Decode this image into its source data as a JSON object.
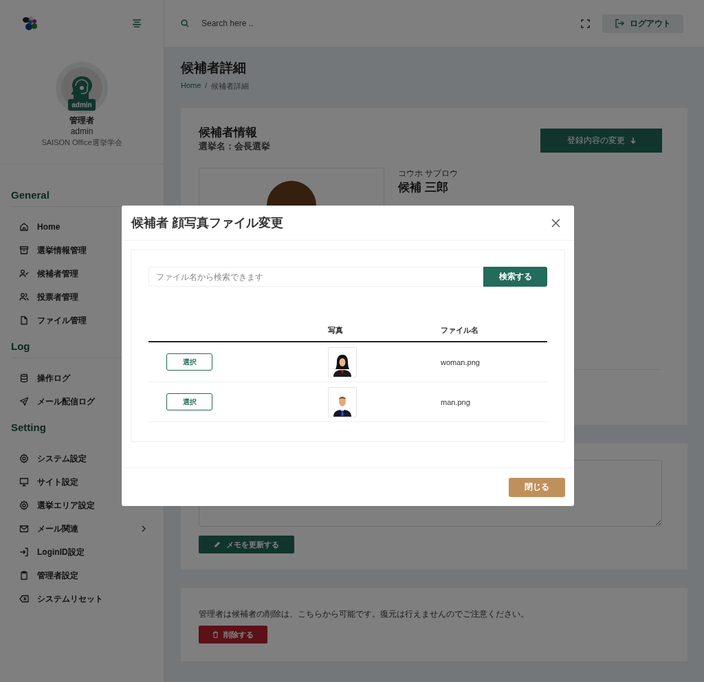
{
  "topbar": {
    "search_placeholder": "Search here ..",
    "logout_button": "ログアウト"
  },
  "profile": {
    "badge": "admin",
    "role": "管理者",
    "username": "admin",
    "organization": "SAISON Office選挙学会"
  },
  "sidebar": {
    "sections": [
      {
        "title": "General",
        "underline": true,
        "items": [
          {
            "label": "Home"
          },
          {
            "label": "選挙情報管理"
          },
          {
            "label": "候補者管理"
          },
          {
            "label": "投票者管理"
          },
          {
            "label": "ファイル管理"
          }
        ]
      },
      {
        "title": "Log",
        "underline": true,
        "items": [
          {
            "label": "操作ログ"
          },
          {
            "label": "メール配信ログ"
          }
        ]
      },
      {
        "title": "Setting",
        "underline": false,
        "items": [
          {
            "label": "システム設定"
          },
          {
            "label": "サイト設定"
          },
          {
            "label": "選挙エリア設定"
          },
          {
            "label": "メール関連",
            "has_submenu": true
          },
          {
            "label": "LoginID設定"
          },
          {
            "label": "管理者設定"
          },
          {
            "label": "システムリセット"
          }
        ]
      }
    ]
  },
  "page": {
    "title": "候補者詳細",
    "breadcrumb": [
      "Home",
      "候補者詳細"
    ],
    "breadcrumb_separator": "/"
  },
  "candidate_card": {
    "title": "候補者情報",
    "election": "選挙名：会長選挙",
    "edit_button": "登録内容の変更",
    "kana": "コウホ サブロウ",
    "name": "候補 三郎"
  },
  "memo_card": {
    "update_button": "メモを更新する"
  },
  "delete_card": {
    "notice": "管理者は候補者の削除は、こちらから可能です。復元は行えませんのでご注意ください。",
    "delete_button": "削除する"
  },
  "modal": {
    "title": "候補者 顔写真ファイル変更",
    "search_placeholder": "ファイル名から検索できます",
    "search_button": "検索する",
    "columns": [
      "写真",
      "ファイル名"
    ],
    "rows": [
      {
        "select_button": "選択",
        "kind": "female",
        "file_name": "woman.png"
      },
      {
        "select_button": "選択",
        "kind": "male",
        "file_name": "man.png"
      }
    ],
    "close_button": "閉じる"
  }
}
